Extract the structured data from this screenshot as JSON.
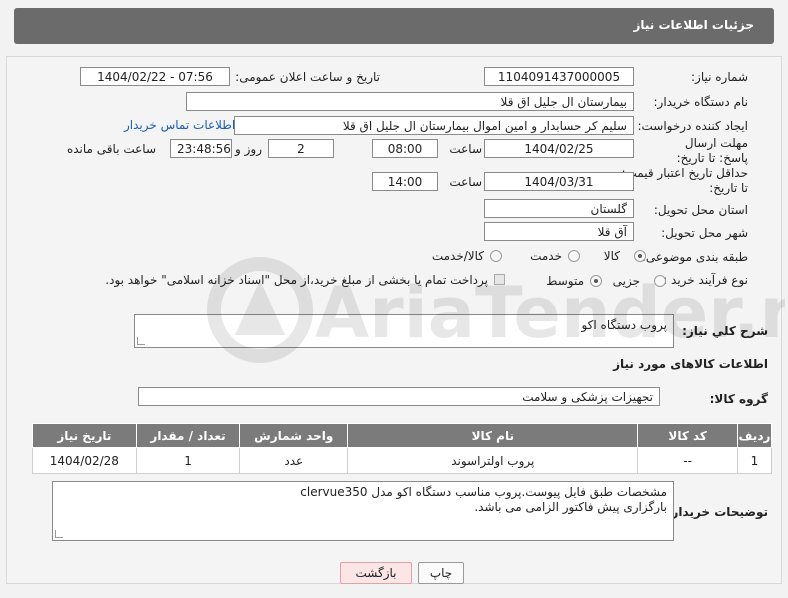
{
  "header": {
    "title": "جزئیات اطلاعات نیاز"
  },
  "fields": {
    "need_number_label": "شماره نیاز:",
    "need_number": "1104091437000005",
    "announce_label": "تاریخ و ساعت اعلان عمومی:",
    "announce_value": "1404/02/22 - 07:56",
    "buyer_org_label": "نام دستگاه خریدار:",
    "buyer_org": "بیمارستان ال جلیل اق قلا",
    "creator_label": "ایجاد کننده درخواست:",
    "creator": "سلیم کر حسابدار و امین اموال بیمارستان ال جلیل اق قلا",
    "contact_link": "اطلاعات تماس خریدار",
    "reply_deadline_label": "مهلت ارسال پاسخ: تا تاریخ:",
    "reply_date": "1404/02/25",
    "time_label": "ساعت",
    "reply_time": "08:00",
    "days_value": "2",
    "days_label": "روز و",
    "remaining_time": "23:48:56",
    "remaining_label": "ساعت باقی مانده",
    "price_validity_label": "حداقل تاریخ اعتبار قیمت: تا تاریخ:",
    "validity_date": "1404/03/31",
    "validity_time": "14:00",
    "province_label": "استان محل تحویل:",
    "province": "گلستان",
    "city_label": "شهر محل تحویل:",
    "city": "آق قلا",
    "category_label": "طبقه بندی موضوعی:",
    "category_options": [
      "کالا",
      "خدمت",
      "کالا/خدمت"
    ],
    "process_label": "نوع فرآیند خرید :",
    "process_options": [
      "جزیی",
      "متوسط"
    ],
    "payment_note": "پرداخت تمام یا بخشی از مبلغ خرید،از محل \"اسناد خزانه اسلامی\" خواهد بود.",
    "summary_label": "شرح کلي نياز:",
    "summary_value": "پروب دستگاه اکو",
    "goods_info_title": "اطلاعات کالاهای مورد نیاز",
    "goods_group_label": "گروه کالا:",
    "goods_group": "تجهیزات پزشکی و سلامت",
    "buyer_notes_label": "توضیحات خریدار:",
    "buyer_notes_line1": "مشخصات طبق فایل پیوست.پروب مناسب دستگاه اکو مدل clervue350",
    "buyer_notes_line2": "بارگزاری پیش فاکتور الزامی می باشد."
  },
  "table": {
    "headers": [
      "ردیف",
      "کد کالا",
      "نام کالا",
      "واحد شمارش",
      "تعداد / مقدار",
      "تاریخ نیاز"
    ],
    "rows": [
      [
        "1",
        "--",
        "پروب اولتراسوند",
        "عدد",
        "1",
        "1404/02/28"
      ]
    ]
  },
  "buttons": {
    "print": "چاپ",
    "back": "بازگشت"
  },
  "watermark": {
    "text": "AriaTender.neT"
  },
  "colors": {
    "header_bg": "#6b6b6b",
    "link": "#1a5fb4",
    "back_bg": "#fbe5e5"
  }
}
